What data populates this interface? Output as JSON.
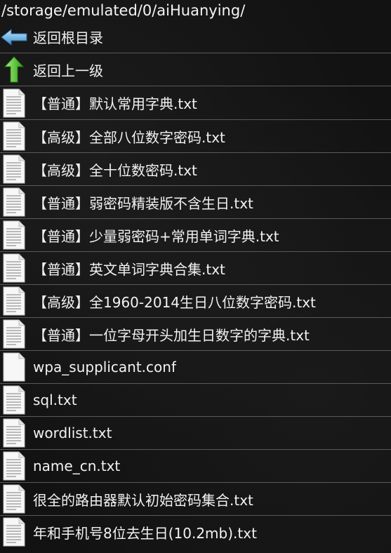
{
  "path": "/storage/emulated/0/aiHuanying/",
  "nav": [
    {
      "label": "返回根目录",
      "icon": "back-arrow-icon"
    },
    {
      "label": "返回上一级",
      "icon": "up-arrow-icon"
    }
  ],
  "files": [
    {
      "name": "【普通】默认常用字典.txt",
      "icon": "text-file-icon"
    },
    {
      "name": "【高级】全部八位数字密码.txt",
      "icon": "text-file-icon"
    },
    {
      "name": "【高级】全十位数密码.txt",
      "icon": "text-file-icon"
    },
    {
      "name": "【普通】弱密码精装版不含生日.txt",
      "icon": "text-file-icon"
    },
    {
      "name": "【普通】少量弱密码+常用单词字典.txt",
      "icon": "text-file-icon"
    },
    {
      "name": "【普通】英文单词字典合集.txt",
      "icon": "text-file-icon"
    },
    {
      "name": "【高级】全1960-2014生日八位数字密码.txt",
      "icon": "text-file-icon"
    },
    {
      "name": "【普通】一位字母开头加生日数字的字典.txt",
      "icon": "text-file-icon"
    },
    {
      "name": "wpa_supplicant.conf",
      "icon": "blank-file-icon"
    },
    {
      "name": "sql.txt",
      "icon": "text-file-icon"
    },
    {
      "name": "wordlist.txt",
      "icon": "text-file-icon"
    },
    {
      "name": "name_cn.txt",
      "icon": "text-file-icon"
    },
    {
      "name": "很全的路由器默认初始密码集合.txt",
      "icon": "text-file-icon"
    },
    {
      "name": "年和手机号8位去生日(10.2mb).txt",
      "icon": "text-file-icon"
    }
  ],
  "colors": {
    "background": "#141414",
    "divider": "#5a5a5a",
    "text": "#f2f2f2",
    "back_arrow": "#5fb4e6",
    "up_arrow": "#5fcf3a"
  }
}
